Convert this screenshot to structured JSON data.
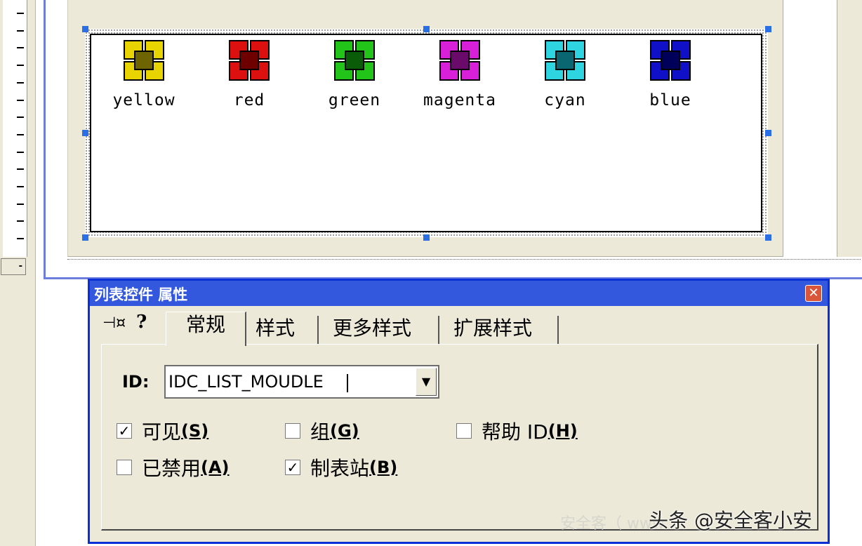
{
  "ruler": {
    "button_label": "-"
  },
  "list_items": [
    {
      "label": "yellow",
      "icon": "yellow-squares-icon",
      "color": "#e8d400",
      "dark": "#6e6400"
    },
    {
      "label": "red",
      "icon": "red-squares-icon",
      "color": "#dd1010",
      "dark": "#6e0000"
    },
    {
      "label": "green",
      "icon": "green-squares-icon",
      "color": "#22c41a",
      "dark": "#0a5c08"
    },
    {
      "label": "magenta",
      "icon": "magenta-squares-icon",
      "color": "#d820d8",
      "dark": "#6a0a6a"
    },
    {
      "label": "cyan",
      "icon": "cyan-squares-icon",
      "color": "#2ed4e0",
      "dark": "#0a6670"
    },
    {
      "label": "blue",
      "icon": "blue-squares-icon",
      "color": "#1010c8",
      "dark": "#00005a"
    }
  ],
  "properties": {
    "title": "列表控件 属性",
    "close_symbol": "✕",
    "pin_symbol": "⊣¤",
    "help_symbol": "?",
    "tabs": [
      "常规",
      "样式",
      "更多样式",
      "扩展样式"
    ],
    "id_label": "ID:",
    "id_value": "IDC_LIST_MOUDLE",
    "dropdown_symbol": "▼",
    "checkboxes": [
      {
        "label": "可见",
        "key": "(S)",
        "checked": true
      },
      {
        "label": "组",
        "key": "(G)",
        "checked": false
      },
      {
        "label": "帮助 ID",
        "key": "(H)",
        "checked": false
      },
      {
        "label": "已禁用",
        "key": "(A)",
        "checked": false
      },
      {
        "label": "制表站",
        "key": "(B)",
        "checked": true
      }
    ]
  },
  "watermark": {
    "faint": "安全客（ www",
    "text": "头条 @安全客小安"
  },
  "colors": {
    "title_bar": "#3458dd",
    "frame_border": "#0a2fd6",
    "dialog_bg": "#ece9d8",
    "selection_handle": "#2b6fe5"
  }
}
